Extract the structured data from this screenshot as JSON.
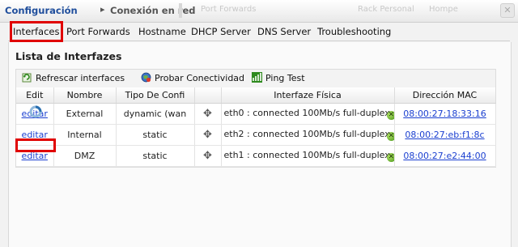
{
  "header": {
    "breadcrumb_root": "Configuración",
    "breadcrumb_separator": "▸",
    "breadcrumb_current": "Conexión en red",
    "background_tabs": [
      "Port Forwards",
      "Rack Personal",
      "Hompe"
    ]
  },
  "tabs": [
    {
      "label": "Interfaces",
      "active": true
    },
    {
      "label": "Port Forwards"
    },
    {
      "label": "Hostname"
    },
    {
      "label": "DHCP Server"
    },
    {
      "label": "DNS Server"
    },
    {
      "label": "Troubleshooting"
    }
  ],
  "panel": {
    "title": "Lista de Interfazes",
    "toolbar": {
      "refresh": "Refrescar interfaces",
      "test_connectivity": "Probar Conectividad",
      "ping": "Ping Test"
    }
  },
  "table": {
    "columns": [
      "Edit",
      "Nombre",
      "Tipo De Confi",
      "",
      "Interfaze Física",
      "Dirección MAC"
    ],
    "rows": [
      {
        "edit": "editar",
        "name": "External",
        "type": "dynamic (wan",
        "iface": "eth0 : connected 100Mb/s full-duplex",
        "mac": "08:00:27:18:33:16"
      },
      {
        "edit": "editar",
        "name": "Internal",
        "type": "static",
        "iface": "eth2 : connected 100Mb/s full-duplex",
        "mac": "08:00:27:eb:f1:8c"
      },
      {
        "edit": "editar",
        "name": "DMZ",
        "type": "static",
        "iface": "eth1 : connected 100Mb/s full-duplex",
        "mac": "08:00:27:e2:44:00"
      }
    ]
  },
  "colors": {
    "link": "#1a3fd0",
    "highlight": "#e00000",
    "header_text": "#1f4e9c"
  }
}
